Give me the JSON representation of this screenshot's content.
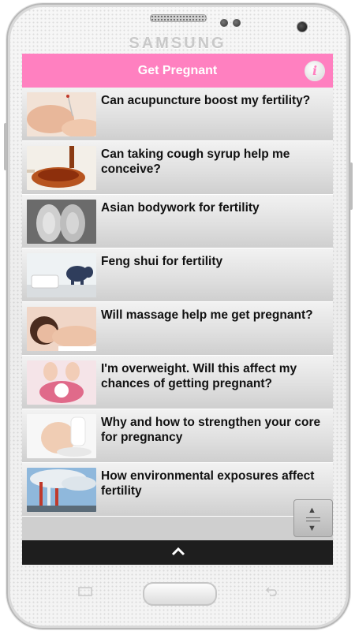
{
  "device": {
    "brand": "SAMSUNG"
  },
  "app": {
    "title": "Get Pregnant",
    "info_label": "i",
    "accent_color": "#ff80c0"
  },
  "articles": [
    {
      "title": "Can acupuncture boost my fertility?",
      "thumb": "acupuncture"
    },
    {
      "title": "Can taking cough syrup help me conceive?",
      "thumb": "cough-syrup"
    },
    {
      "title": "Asian bodywork for fertility",
      "thumb": "baby-feet"
    },
    {
      "title": "Feng shui for fertility",
      "thumb": "nursery-elephant"
    },
    {
      "title": "Will massage help me get pregnant?",
      "thumb": "massage"
    },
    {
      "title": "I'm overweight. Will this affect my chances of getting pregnant?",
      "thumb": "scale"
    },
    {
      "title": "Why and how to strengthen your core for pregnancy",
      "thumb": "pregnant-belly"
    },
    {
      "title": "How environmental exposures affect fertility",
      "thumb": "smokestack"
    }
  ],
  "bottom_bar": {
    "icon": "chevron-up-icon"
  },
  "scroll_widget": {
    "icon": "scroll-icon"
  }
}
